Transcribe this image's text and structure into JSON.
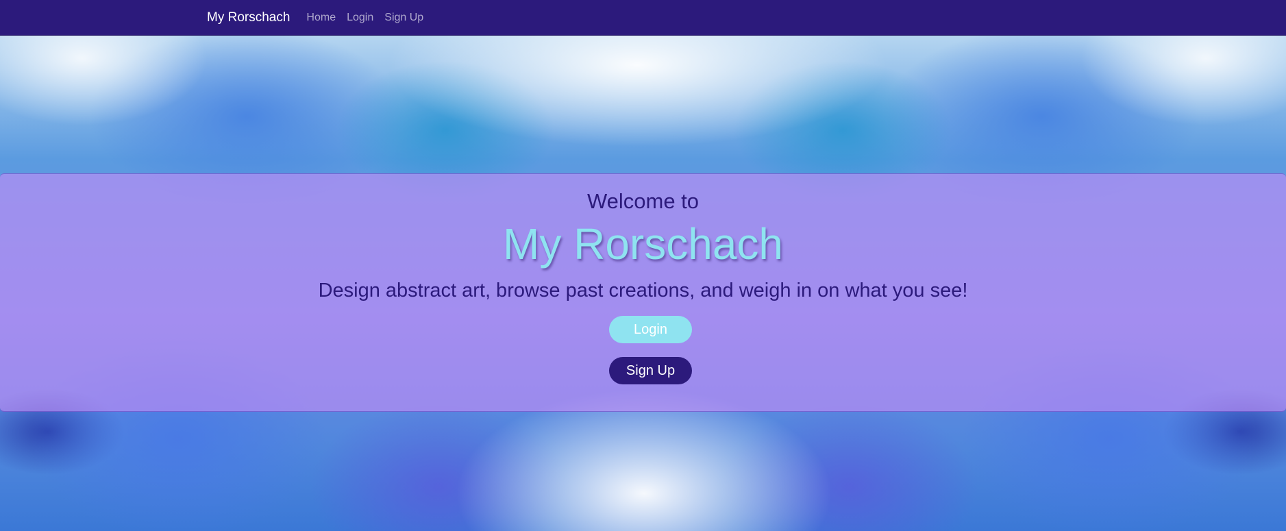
{
  "colors": {
    "navbar": "#2c1a7c",
    "accent": "#8fe3f0",
    "primary_text": "#2c1a7c",
    "hero_overlay": "#c48cf5"
  },
  "navbar": {
    "brand": "My Rorschach",
    "links": [
      "Home",
      "Login",
      "Sign Up"
    ]
  },
  "hero": {
    "welcome": "Welcome to",
    "title": "My Rorschach",
    "tagline": "Design abstract art, browse past creations, and weigh in on what you see!",
    "login_label": "Login",
    "signup_label": "Sign Up"
  }
}
